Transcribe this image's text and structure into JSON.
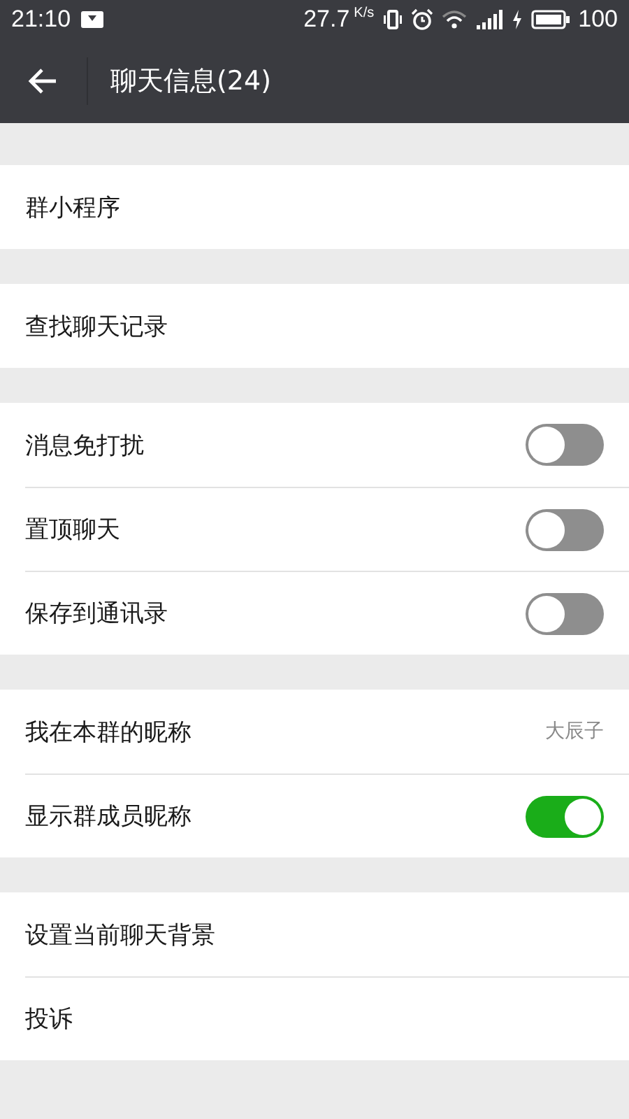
{
  "status_bar": {
    "time": "21:10",
    "speed": "27.7",
    "speed_unit": "K/s",
    "battery": "100"
  },
  "header": {
    "title": "聊天信息(24)"
  },
  "sections": [
    {
      "rows": [
        {
          "kind": "link",
          "label": "群小程序"
        }
      ]
    },
    {
      "rows": [
        {
          "kind": "link",
          "label": "查找聊天记录"
        }
      ]
    },
    {
      "rows": [
        {
          "kind": "toggle",
          "label": "消息免打扰",
          "on": false
        },
        {
          "kind": "toggle",
          "label": "置顶聊天",
          "on": false
        },
        {
          "kind": "toggle",
          "label": "保存到通讯录",
          "on": false
        }
      ]
    },
    {
      "rows": [
        {
          "kind": "value",
          "label": "我在本群的昵称",
          "value": "大辰子"
        },
        {
          "kind": "toggle",
          "label": "显示群成员昵称",
          "on": true
        }
      ]
    },
    {
      "rows": [
        {
          "kind": "link",
          "label": "设置当前聊天背景"
        },
        {
          "kind": "link",
          "label": "投诉"
        }
      ]
    }
  ]
}
